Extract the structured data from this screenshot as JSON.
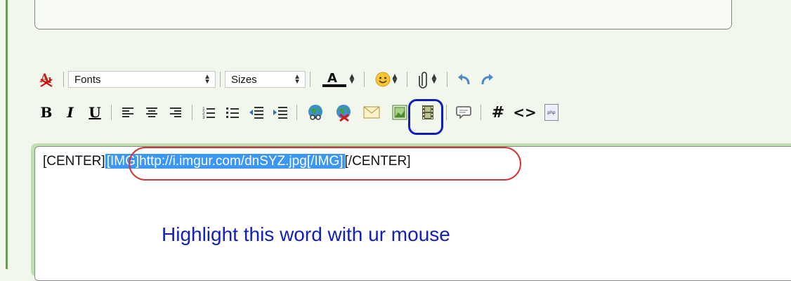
{
  "toolbar_row1": {
    "fonts_label": "Fonts",
    "sizes_label": "Sizes"
  },
  "toolbar_row2": {
    "bold_label": "B",
    "italic_label": "I",
    "underline_label": "U",
    "hash_label": "#",
    "code_label": "<>",
    "php_label": "php"
  },
  "editor": {
    "code_before": "[CENTER]",
    "code_selected": "[IMG]http://i.imgur.com/dnSYZ.jpg[/IMG]",
    "code_after": "[/CENTER]",
    "instruction_text": "Highlight this word with ur mouse"
  },
  "colors": {
    "highlight_box": "#0e1fb7",
    "oval": "#d23636",
    "selection": "#3b97f5",
    "instruction": "#1221b8"
  },
  "icons": [
    "remove-format-icon",
    "font-color-icon",
    "smiley-icon",
    "attachment-icon",
    "undo-icon",
    "redo-icon",
    "align-left-icon",
    "align-center-icon",
    "align-right-icon",
    "ordered-list-icon",
    "unordered-list-icon",
    "outdent-icon",
    "indent-icon",
    "insert-image-icon",
    "remove-link-icon",
    "email-icon",
    "image-frame-icon",
    "film-icon",
    "quote-icon",
    "php-icon"
  ]
}
